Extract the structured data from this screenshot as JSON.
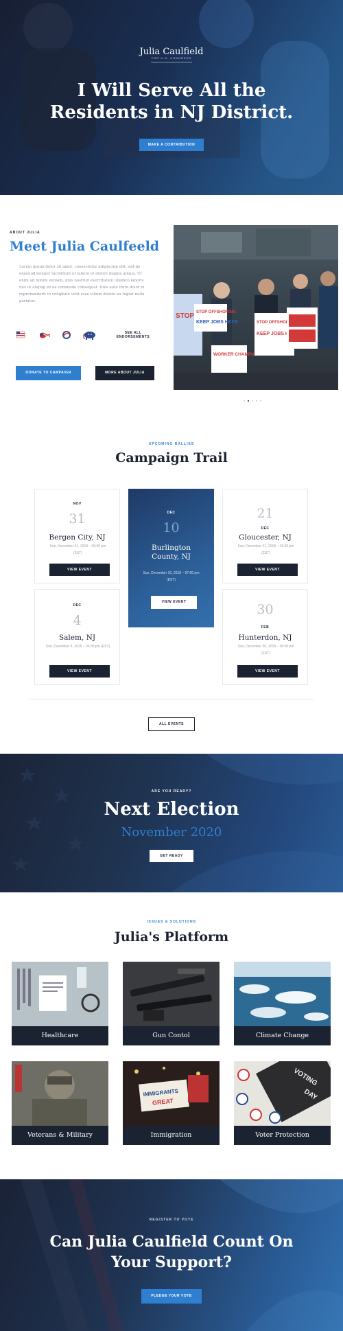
{
  "hero": {
    "logo_name": "Julia Caulfield",
    "logo_sub": "FOR U.S. CONGRESS",
    "title": "I Will Serve All the Residents in NJ District.",
    "button": "MAKE A CONTRIBUTION"
  },
  "about": {
    "kicker": "ABOUT JULIA",
    "title": "Meet Julia Caulfeeld",
    "text": "Lorem ipsum dolor sit amet, consectetur adipiscing elit, sed do eiusmod tempor incididunt ut labore et dolore magna aliqua. Ut enim ad minim veniam, quis nostrud exercitation ullamco laboris nisi ut aliquip ex ea commodo consequat. Duis aute irure dolor in reprehenderit in voluptate velit esse cillum dolore eu fugiat nulla pariatur.",
    "endorsements_label": "SEE ALL ENDORSEMENTS",
    "donate_button": "DONATE TO CAMPAIGN",
    "more_button": "MORE ABOUT JULIA",
    "photo_signs": [
      "STOP OFFSHORING",
      "KEEP JOBS HERE",
      "WORKER CHAMPION",
      "STOP OFFSHORING",
      "KEEP JOBS HERE"
    ]
  },
  "trail": {
    "kicker": "UPCOMING RALLIES",
    "title": "Campaign Trail",
    "events": [
      {
        "month": "NOV",
        "day": "31",
        "city": "Bergen City, NJ",
        "date": "Sun, November 31, 2018 – 09:00 pm (EST)",
        "button": "VIEW EVENT"
      },
      {
        "month": "DEC",
        "day": "10",
        "city": "Burlington County, NJ",
        "date": "Sun, December 10, 2018 – 07:00 pm (EST)",
        "button": "VIEW EVENT"
      },
      {
        "month": "DEC",
        "day": "21",
        "city": "Gloucester, NJ",
        "date": "Sun, December 21, 2018 – 03:00 pm (EST)",
        "button": "VIEW EVENT"
      },
      {
        "month": "DEC",
        "day": "4",
        "city": "Salem, NJ",
        "date": "Sun, December 4, 2018 – 06:30 pm (EST)",
        "button": "VIEW EVENT"
      },
      {
        "month": "FEB",
        "day": "30",
        "city": "Hunterdon, NJ",
        "date": "Sun, December 30, 2018 – 09:00 pm (EST)",
        "button": "VIEW EVENT"
      }
    ],
    "all_button": "ALL EVENTS"
  },
  "election": {
    "kicker": "ARE YOU READY?",
    "title": "Next Election",
    "subtitle": "November 2020",
    "button": "GET READY"
  },
  "platform": {
    "kicker": "ISSUES & SOLUTIONS",
    "title": "Julia's Platform",
    "items": [
      {
        "label": "Healthcare"
      },
      {
        "label": "Gun Contol"
      },
      {
        "label": "Climate Change"
      },
      {
        "label": "Veterans & Military"
      },
      {
        "label": "Immigration"
      },
      {
        "label": "Voter Protection"
      }
    ],
    "image_signs": [
      "IMMIGRANTS",
      "GREAT",
      "VOTING",
      "DAY"
    ]
  },
  "support": {
    "kicker": "REGISTER TO VOTE",
    "title": "Can Julia Caulfield Count On Your Support?",
    "button": "PLEDGE YOUR VOTE"
  },
  "colors": {
    "accent": "#2f7fd0",
    "dark": "#1b2231",
    "muted": "#9aa0aa"
  }
}
